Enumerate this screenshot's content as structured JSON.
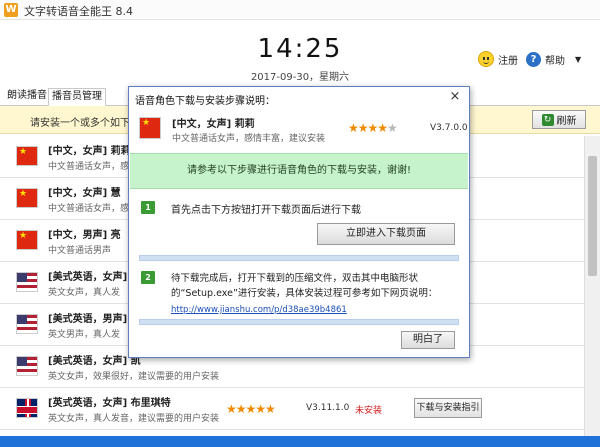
{
  "window": {
    "title": "文字转语音全能王 8.4",
    "icon_letter": "W"
  },
  "header": {
    "time": "14:25",
    "date": "2017-09-30，星期六",
    "register_label": "注册",
    "help_label": "帮助",
    "help_glyph": "?"
  },
  "tabs": [
    {
      "label": "朗读播音"
    },
    {
      "label": "播音员管理"
    }
  ],
  "notice": {
    "text": "请安装一个或多个如下列出"
  },
  "toolbar": {
    "refresh_label": "刷新"
  },
  "voices": [
    {
      "name": "[中文，女声] 莉莉",
      "desc": "中文普通话女声，感情丰",
      "flag": "cn",
      "stars": "",
      "version": "",
      "status": "",
      "button": ""
    },
    {
      "name": "[中文，女声] 慧",
      "desc": "中文普通话女声，感情",
      "flag": "cn",
      "stars": "",
      "version": "",
      "status": "",
      "button": ""
    },
    {
      "name": "[中文，男声] 亮",
      "desc": "中文普通话男声",
      "flag": "cn",
      "stars": "",
      "version": "",
      "status": "",
      "button": ""
    },
    {
      "name": "[美式英语，女声] 朱",
      "desc": "英文女声，真人发",
      "flag": "us",
      "stars": "",
      "version": "",
      "status": "",
      "button": ""
    },
    {
      "name": "[美式英语，男声] 保",
      "desc": "英文男声，真人发",
      "flag": "us",
      "stars": "",
      "version": "",
      "status": "",
      "button": ""
    },
    {
      "name": "[美式英语，女声] 凯",
      "desc": "英文女声，效果很好，建议需要的用户安装",
      "flag": "us",
      "stars": "",
      "version": "",
      "status": "",
      "button": ""
    },
    {
      "name": "[英式英语，女声] 布里琪特",
      "desc": "英文女声，真人发音，建议需要的用户安装",
      "flag": "uk",
      "stars": "★★★★★",
      "version": "V3.11.1.0",
      "status": "未安装",
      "button": "下载与安装指引"
    }
  ],
  "dialog": {
    "title": "语音角色下载与安装步骤说明：",
    "close_glyph": "×",
    "voice_name": "[中文，女声] 莉莉",
    "voice_desc": "中文普通话女声，感情丰富，建议安装",
    "stars_filled": "★★★★",
    "stars_empty": "★",
    "version": "V3.7.0.0",
    "banner": "请参考以下步骤进行语音角色的下载与安装，谢谢!",
    "step1_num": "1",
    "step1_text": "首先点击下方按钮打开下载页面后进行下载",
    "step1_button": "立即进入下载页面",
    "step2_num": "2",
    "step2_text": "待下载完成后，打开下载到的压缩文件，双击其中电脑形状的“Setup.exe”进行安装，具体安装过程可参考如下网页说明：",
    "step2_link": "http://www.jianshu.com/p/d38ae39b4861",
    "ok_button": "明白了"
  },
  "colors": {
    "accent": "#1f73d8",
    "star": "#f08a00",
    "status_red": "#d21f1f",
    "banner_green": "#c6f2cc",
    "notice_yellow": "#fff7cf"
  }
}
